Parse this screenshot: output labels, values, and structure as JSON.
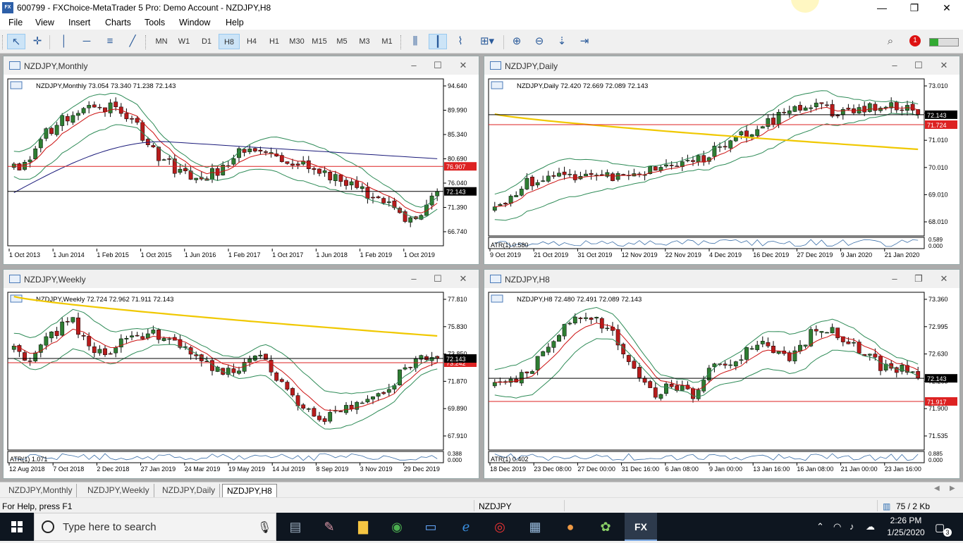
{
  "window": {
    "title": "600799 - FXChoice-MetaTrader 5 Pro: Demo Account - NZDJPY,H8",
    "logo_text": "FX Choice",
    "minimize_glyph": "—",
    "maximize_glyph": "❐",
    "close_glyph": "✕"
  },
  "menu": {
    "items": [
      "File",
      "View",
      "Insert",
      "Charts",
      "Tools",
      "Window",
      "Help"
    ]
  },
  "toolbar": {
    "timeframes": [
      "MN",
      "W1",
      "D1",
      "H8",
      "H4",
      "H1",
      "M30",
      "M15",
      "M5",
      "M3",
      "M1"
    ],
    "active_timeframe": "H8",
    "icons": [
      "cursor-icon",
      "crosshair-icon",
      "vertical-line-icon",
      "horizontal-line-icon",
      "fibonacci-icon",
      "trendline-icon",
      "bar-chart-icon",
      "candlestick-icon",
      "line-chart-icon",
      "indicators-icon",
      "zoom-in-icon",
      "zoom-out-icon",
      "autoscroll-icon",
      "chart-shift-icon",
      "search-icon",
      "bell-icon"
    ],
    "notification_count": "1"
  },
  "colors": {
    "bull": "#2e7d32",
    "bear": "#b71c1c",
    "ema": "#cc1111",
    "bands": "#2e8b57",
    "slow_ma_navy": "#1a1a7a",
    "slow_ma_gold": "#f0c800",
    "hline_red": "#dd2222",
    "price_line": "#000000"
  },
  "charts": [
    {
      "key": "monthly",
      "window_title": "NZDJPY,Monthly",
      "header": "NZDJPY,Monthly  73.054 73.340 71.238 72.143",
      "price_ticks": [
        "94.640",
        "89.990",
        "85.340",
        "80.690",
        "76.040",
        "71.390",
        "66.740"
      ],
      "last_price": "72.143",
      "red_level": "76.907",
      "time_ticks": [
        "1 Oct 2013",
        "1 Jun 2014",
        "1 Feb 2015",
        "1 Oct 2015",
        "1 Jun 2016",
        "1 Feb 2017",
        "1 Oct 2017",
        "1 Jun 2018",
        "1 Feb 2019",
        "1 Oct 2019"
      ],
      "atr_label": "",
      "atr_values": [],
      "maximized": false
    },
    {
      "key": "daily",
      "window_title": "NZDJPY,Daily",
      "header": "NZDJPY,Daily  72.420 72.669 72.089 72.143",
      "price_ticks": [
        "73.010",
        "72.010",
        "71.010",
        "70.010",
        "69.010",
        "68.010"
      ],
      "last_price": "72.143",
      "red_level": "71.724",
      "time_ticks": [
        "9 Oct 2019",
        "21 Oct 2019",
        "31 Oct 2019",
        "12 Nov 2019",
        "22 Nov 2019",
        "4 Dec 2019",
        "16 Dec 2019",
        "27 Dec 2019",
        "9 Jan 2020",
        "21 Jan 2020"
      ],
      "atr_label": "ATR(1) 0.580",
      "atr_values": [
        "0.589",
        "0.000"
      ],
      "maximized": false
    },
    {
      "key": "weekly",
      "window_title": "NZDJPY,Weekly",
      "header": "NZDJPY,Weekly  72.724 72.962 71.911 72.143",
      "price_ticks": [
        "77.810",
        "75.830",
        "73.850",
        "71.870",
        "69.890",
        "67.910"
      ],
      "last_price": "72.143",
      "red_level": "73.242",
      "time_ticks": [
        "12 Aug 2018",
        "7 Oct 2018",
        "2 Dec 2018",
        "27 Jan 2019",
        "24 Mar 2019",
        "19 May 2019",
        "14 Jul 2019",
        "8 Sep 2019",
        "3 Nov 2019",
        "29 Dec 2019"
      ],
      "atr_label": "ATR(1) 1.071",
      "atr_values": [
        "0.388",
        "0.000"
      ],
      "maximized": false
    },
    {
      "key": "h8",
      "window_title": "NZDJPY,H8",
      "header": "NZDJPY,H8  72.480 72.491 72.089 72.143",
      "price_ticks": [
        "73.360",
        "72.995",
        "72.630",
        "72.265",
        "71.900",
        "71.535"
      ],
      "last_price": "72.143",
      "red_level": "71.917",
      "time_ticks": [
        "18 Dec 2019",
        "23 Dec 08:00",
        "27 Dec 00:00",
        "31 Dec 16:00",
        "6 Jan 08:00",
        "9 Jan 00:00",
        "13 Jan 16:00",
        "16 Jan 08:00",
        "21 Jan 00:00",
        "23 Jan 16:00"
      ],
      "atr_label": "ATR(1) 0.402",
      "atr_values": [
        "0.885",
        "0.000"
      ],
      "maximized": true
    }
  ],
  "tabs": {
    "items": [
      "NZDJPY,Monthly",
      "NZDJPY,Weekly",
      "NZDJPY,Daily",
      "NZDJPY,H8"
    ],
    "active": "NZDJPY,H8"
  },
  "status": {
    "help": "For Help, press F1",
    "symbol": "NZDJPY",
    "traffic": "75 / 2 Kb"
  },
  "taskbar": {
    "search_placeholder": "Type here to search",
    "apps": [
      "file-explorer-icon",
      "paint-icon",
      "folder-icon",
      "whatsapp-icon",
      "monitor-icon",
      "edge-icon",
      "media-icon",
      "network-icon",
      "chrome-icon",
      "settings-icon",
      "fxchoice-icon"
    ],
    "fx_label": "FX",
    "time": "2:26 PM",
    "date": "1/25/2020",
    "notification_count": "3"
  }
}
